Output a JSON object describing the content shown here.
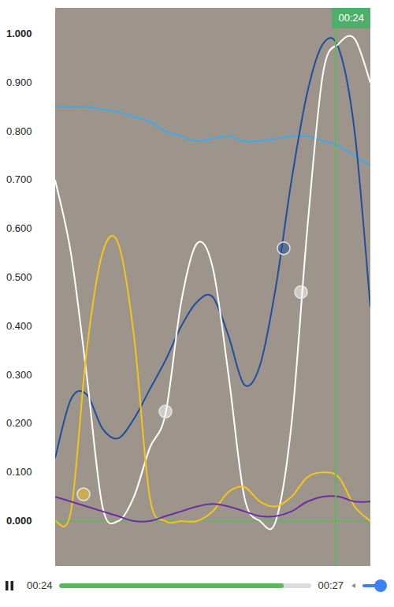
{
  "chart": {
    "y_ticks": [
      {
        "label": "1.000",
        "value": 1,
        "bold": true
      },
      {
        "label": "0.900",
        "value": 0.9,
        "bold": false
      },
      {
        "label": "0.800",
        "value": 0.8,
        "bold": false
      },
      {
        "label": "0.700",
        "value": 0.7,
        "bold": false
      },
      {
        "label": "0.600",
        "value": 0.6,
        "bold": false
      },
      {
        "label": "0.500",
        "value": 0.5,
        "bold": false
      },
      {
        "label": "0.400",
        "value": 0.4,
        "bold": false
      },
      {
        "label": "0.300",
        "value": 0.3,
        "bold": false
      },
      {
        "label": "0.200",
        "value": 0.2,
        "bold": false
      },
      {
        "label": "0.100",
        "value": 0.1,
        "bold": false
      },
      {
        "label": "0.000",
        "value": 0,
        "bold": true
      }
    ],
    "series": [
      {
        "color": "#3fa9e8",
        "values": [
          0.85,
          0.85,
          0.85,
          0.845,
          0.84,
          0.83,
          0.82,
          0.8,
          0.79,
          0.78,
          0.785,
          0.79,
          0.78,
          0.78,
          0.785,
          0.79,
          0.79,
          0.78,
          0.77,
          0.75,
          0.73
        ]
      },
      {
        "color": "#1f4e9c",
        "values": [
          0.13,
          0.25,
          0.26,
          0.19,
          0.17,
          0.21,
          0.27,
          0.33,
          0.4,
          0.45,
          0.46,
          0.38,
          0.28,
          0.32,
          0.48,
          0.7,
          0.88,
          0.98,
          0.97,
          0.8,
          0.44
        ]
      },
      {
        "color": "#ffffff",
        "values": [
          0.7,
          0.55,
          0.3,
          0.03,
          0.0,
          0.05,
          0.15,
          0.22,
          0.45,
          0.57,
          0.52,
          0.3,
          0.05,
          0.0,
          0.0,
          0.2,
          0.6,
          0.92,
          0.98,
          0.99,
          0.9
        ]
      },
      {
        "color": "#f5c518",
        "values": [
          0.0,
          0.02,
          0.35,
          0.55,
          0.57,
          0.38,
          0.05,
          0.0,
          0.0,
          0.0,
          0.02,
          0.06,
          0.07,
          0.04,
          0.03,
          0.05,
          0.09,
          0.1,
          0.09,
          0.03,
          0.0
        ]
      },
      {
        "color": "#6b2fa0",
        "values": [
          0.05,
          0.04,
          0.03,
          0.02,
          0.01,
          0.0,
          0.0,
          0.01,
          0.02,
          0.03,
          0.035,
          0.03,
          0.02,
          0.01,
          0.01,
          0.02,
          0.04,
          0.05,
          0.05,
          0.04,
          0.04
        ]
      }
    ],
    "markers": [
      {
        "series": 3,
        "position": 0.09,
        "value": 0.055
      },
      {
        "series": 2,
        "position": 0.35,
        "value": 0.225
      },
      {
        "series": 1,
        "position": 0.725,
        "value": 0.56
      },
      {
        "series": 2,
        "position": 0.78,
        "value": 0.47
      }
    ],
    "cursor": {
      "label": "00:24",
      "level": 0.89
    }
  },
  "player": {
    "playing": true,
    "elapsed": "00:24",
    "duration": "00:27",
    "progress": 0.89,
    "volume": 0.75
  }
}
